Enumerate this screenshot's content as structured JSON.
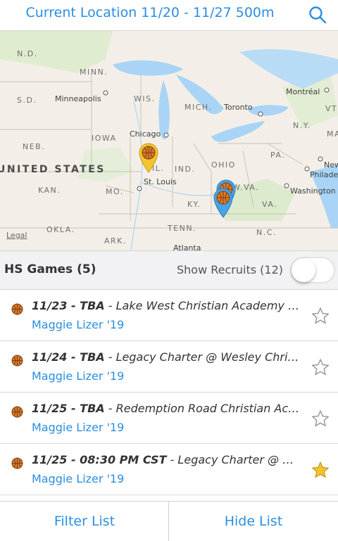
{
  "header": {
    "title": "Current Location 11/20 - 11/27 500m",
    "search_icon": "search-icon"
  },
  "map": {
    "state_labels": [
      "N.D.",
      "MINN.",
      "WIS.",
      "S.D.",
      "MICH.",
      "IOWA",
      "NEB.",
      "IND.",
      "OHIO",
      "PA.",
      "N.Y.",
      "KAN.",
      "MO.",
      "W.VA.",
      "KY.",
      "VA.",
      "TENN.",
      "OKLA.",
      "ARK.",
      "N.C.",
      "VT",
      "MA"
    ],
    "country_label": "UNITED STATES",
    "cities": [
      "Minneapolis",
      "Chicago",
      "Toronto",
      "Montréal",
      "St. Louis",
      "Washington",
      "New",
      "Philade",
      "Atlanta",
      "IL."
    ],
    "legal": "Legal",
    "pins": [
      {
        "name": "basketball-pin-yellow",
        "color": "#f2c530"
      },
      {
        "name": "basketball-pin-blue",
        "color": "#4aa3e6"
      },
      {
        "name": "basketball-pin-blue",
        "color": "#4aa3e6"
      }
    ]
  },
  "section": {
    "title": "HS Games (5)",
    "recruits_label": "Show Recruits (12)",
    "toggle_on": false
  },
  "games": [
    {
      "bold": "11/23 - TBA",
      "rest": " - Lake West Christian Academy vs. Wes…",
      "player": "Maggie Lizer '19",
      "starred": false
    },
    {
      "bold": "11/24 - TBA",
      "rest": " - Legacy Charter @ Wesley Christian School",
      "player": "Maggie Lizer '19",
      "starred": false
    },
    {
      "bold": "11/25 - TBA",
      "rest": " - Redemption Road Christian Academy",
      "player": "Maggie Lizer '19",
      "starred": false
    },
    {
      "bold": "11/25 - 08:30 PM CST",
      "rest": " - Legacy Charter @ Wesley",
      "player": "Maggie Lizer '19",
      "starred": true
    }
  ],
  "footer": {
    "filter_label": "Filter List",
    "hide_label": "Hide List"
  },
  "colors": {
    "accent": "#2a8ee0",
    "star_active": "#f2c530",
    "star_inactive": "#9a9a9a",
    "ball": "#d97a2b"
  }
}
